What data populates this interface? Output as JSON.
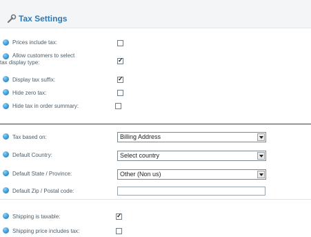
{
  "header": {
    "title": "Tax Settings",
    "icon": "wrench-icon"
  },
  "tax_options": [
    {
      "label": "Prices include tax:",
      "checked": false
    },
    {
      "label": "Allow customers to select",
      "label2": "tax display type:",
      "checked": true
    },
    {
      "label": "Display tax suffix:",
      "checked": true
    },
    {
      "label": "Hide zero tax:",
      "checked": false
    },
    {
      "label": "Hide tax in order summary:",
      "checked": false
    }
  ],
  "location": {
    "tax_based_on": {
      "label": "Tax based on:",
      "value": "Billing Address"
    },
    "default_country": {
      "label": "Default Country:",
      "value": "Select country"
    },
    "default_state": {
      "label": "Default State / Province:",
      "value": "Other (Non us)"
    },
    "default_zip": {
      "label": "Default Zip / Postal code:",
      "value": ""
    }
  },
  "shipping": [
    {
      "label": "Shipping is taxable:",
      "checked": true
    },
    {
      "label": "Shipping price includes tax:",
      "checked": false
    }
  ],
  "colors": {
    "accent": "#2c79b8",
    "help_icon": "#2b8ccb"
  }
}
